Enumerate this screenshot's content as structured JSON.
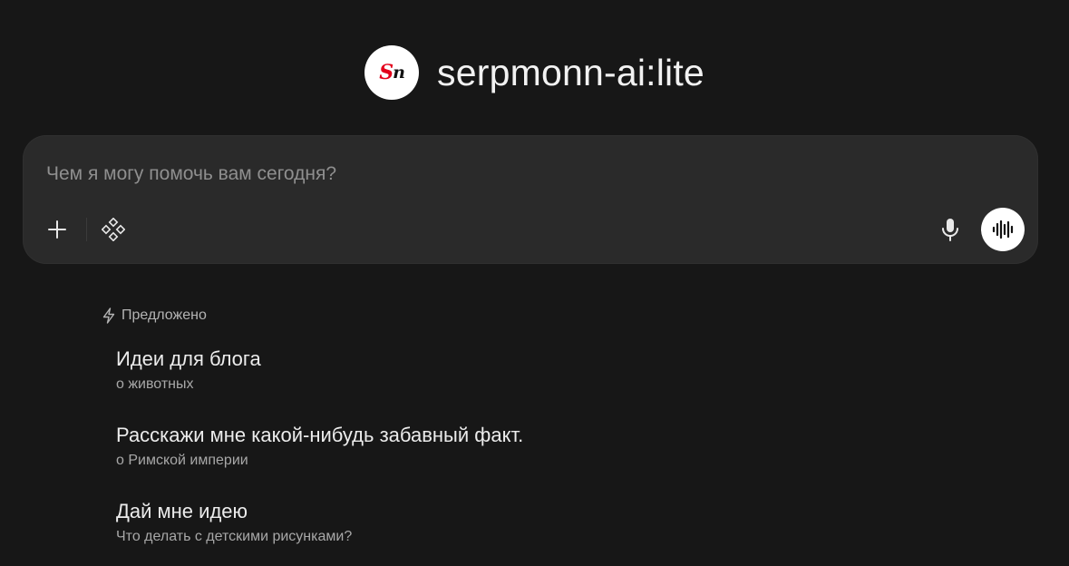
{
  "brand": {
    "logo_text_s": "S",
    "logo_text_n": "n",
    "model_name": "serpmonn-ai:lite"
  },
  "composer": {
    "placeholder": "Чем я могу помочь вам сегодня?",
    "value": "",
    "icons": {
      "add": "plus-icon",
      "tools": "tools-icon",
      "microphone": "microphone-icon",
      "voice": "voice-waveform-icon"
    }
  },
  "suggestions": {
    "header_label": "Предложено",
    "header_icon": "bolt-icon",
    "items": [
      {
        "title": "Идеи для блога",
        "subtitle": "о животных"
      },
      {
        "title": "Расскажи мне какой-нибудь забавный факт.",
        "subtitle": "о Римской империи"
      },
      {
        "title": "Дай мне идею",
        "subtitle": "Что делать с детскими рисунками?"
      }
    ]
  },
  "colors": {
    "background": "#171717",
    "composer": "#2a2a2a",
    "logo_accent": "#e3001b"
  }
}
